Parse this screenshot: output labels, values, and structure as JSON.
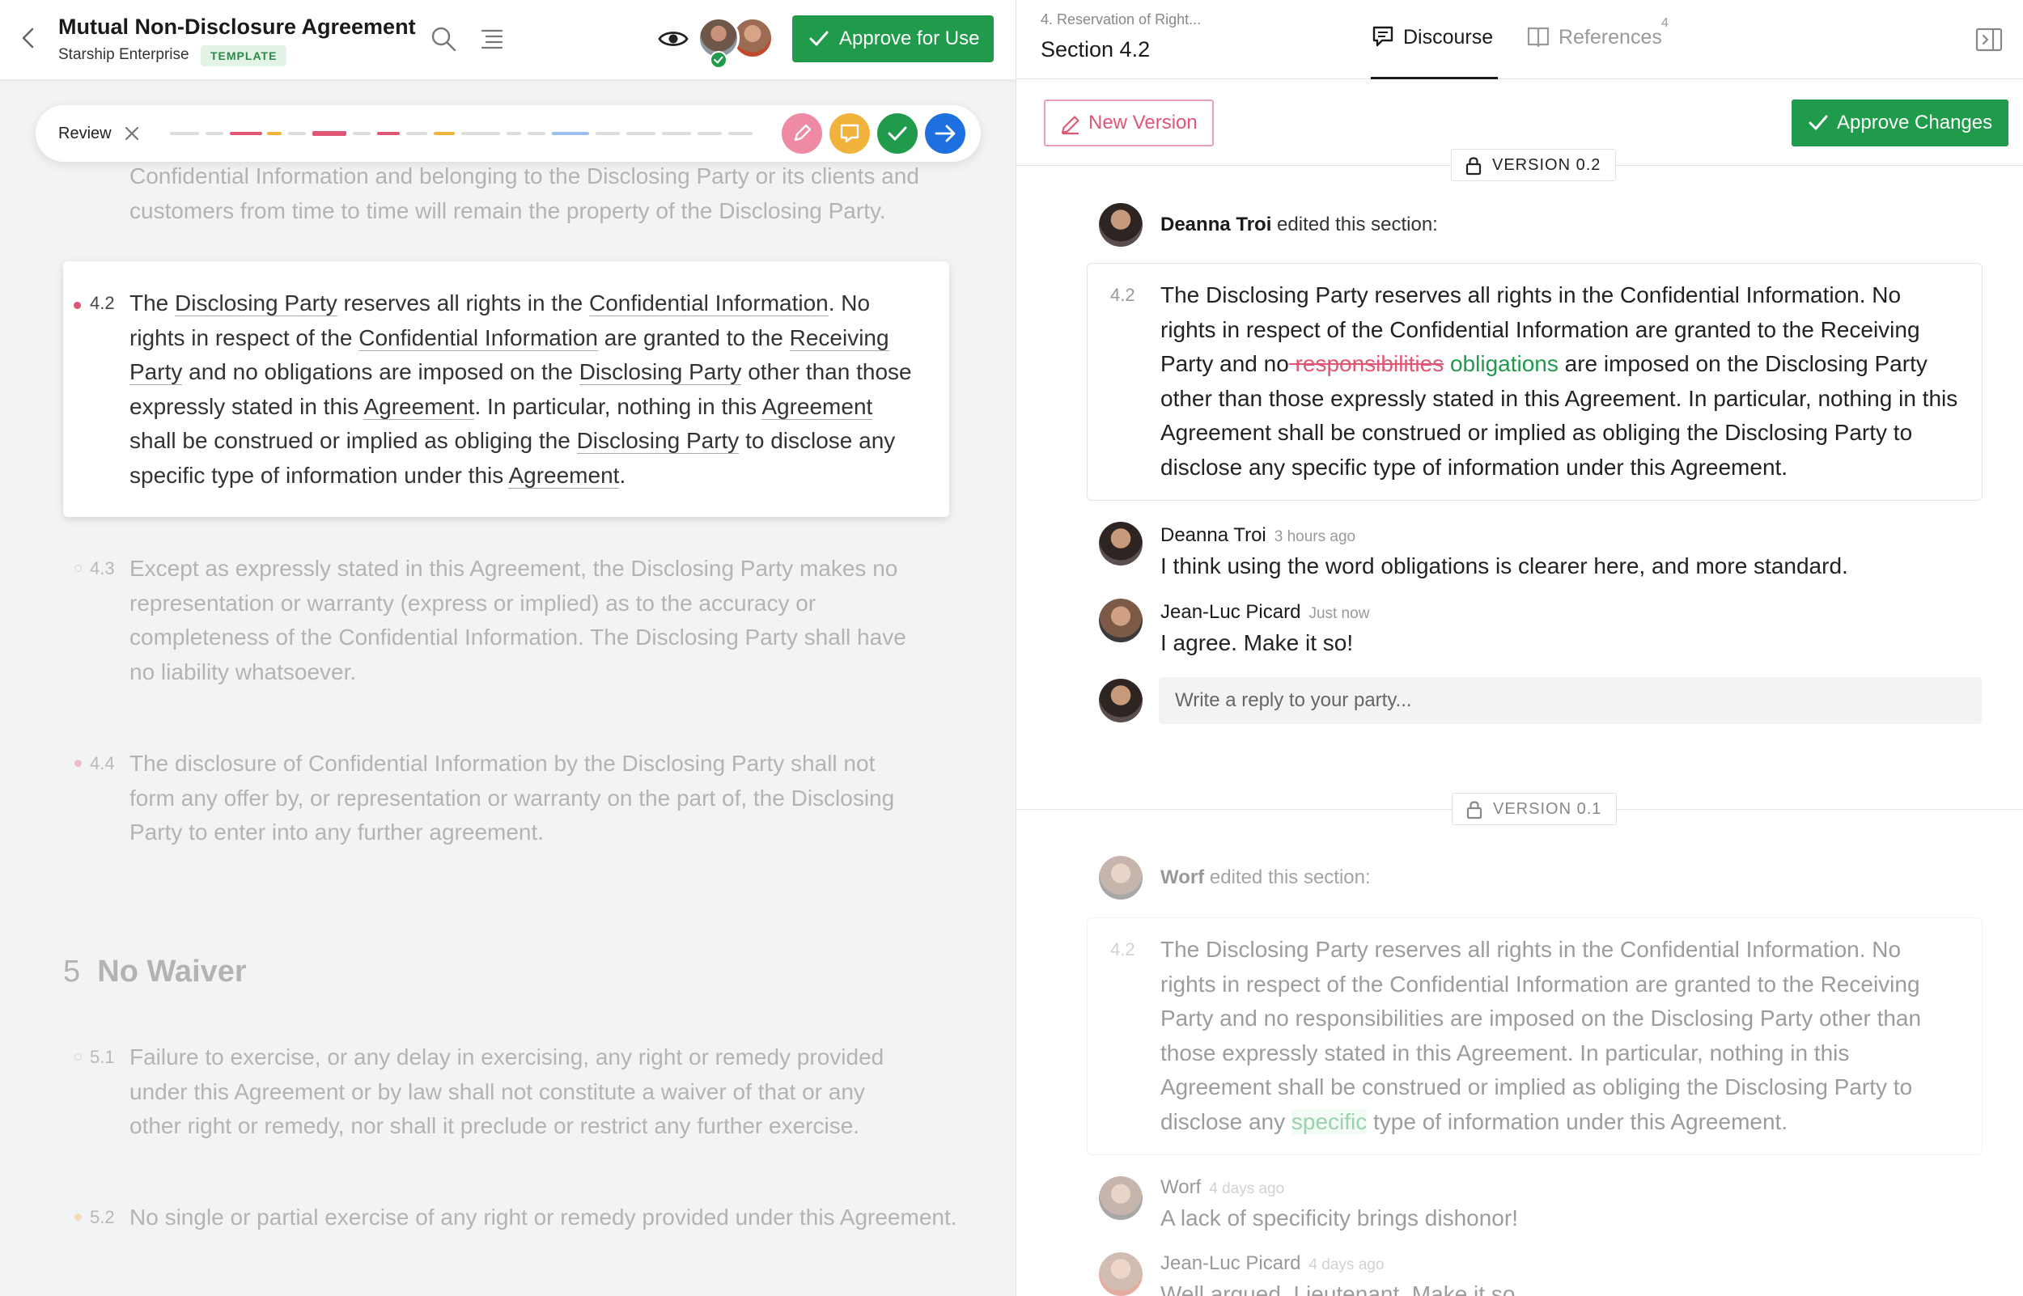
{
  "header": {
    "title": "Mutual Non-Disclosure Agreement",
    "subtitle": "Starship Enterprise",
    "badge": "TEMPLATE",
    "approve_button": "Approve for Use"
  },
  "review": {
    "label": "Review"
  },
  "document": {
    "clause_4_1_tail": "Confidential Information and belonging to the Disclosing Party or its clients and customers from time to time will remain the property of the Disclosing Party.",
    "clause_4_2_num": "4.2",
    "clause_4_2_tokens": [
      "The ",
      "Disclosing Party",
      " reserves all rights in the ",
      "Confidential Information",
      ". No rights in respect of the ",
      "Confidential Information",
      " are granted to the ",
      "Receiving Party",
      " and no obligations are imposed on the ",
      "Disclosing Party",
      " other than those expressly stated in this ",
      "Agreement",
      ". In particular, nothing in this ",
      "Agreement",
      " shall be construed or implied as obliging the ",
      "Disclosing Party",
      " to disclose any specific type of information under this ",
      "Agreement",
      "."
    ],
    "clause_4_3_num": "4.3",
    "clause_4_3": "Except as expressly stated in this Agreement, the Disclosing Party makes no representation or warranty (express or implied) as to the accuracy or completeness of the Confidential Information. The Disclosing Party shall have no liability whatsoever.",
    "clause_4_4_num": "4.4",
    "clause_4_4": "The disclosure of Confidential Information by the Disclosing Party shall not form any offer by, or representation or warranty on the part of, the Disclosing Party to enter into any further agreement.",
    "section_5_num": "5",
    "section_5_title": "No Waiver",
    "clause_5_1_num": "5.1",
    "clause_5_1": "Failure to exercise, or any delay in exercising, any right or remedy provided under this Agreement or by law shall not constitute a waiver of that or any other right or remedy, nor shall it preclude or restrict any further exercise.",
    "clause_5_2_num": "5.2",
    "clause_5_2": "No single or partial exercise of any right or remedy provided under this Agreement."
  },
  "panel": {
    "breadcrumb": "4. Reservation of Right...",
    "section_title": "Section 4.2",
    "tab_discourse": "Discourse",
    "tab_references": "References",
    "references_count": "4",
    "new_version_button": "New Version",
    "approve_changes_button": "Approve Changes",
    "version_2": {
      "label": "VERSION 0.2",
      "editor": "Deanna Troi",
      "edited_suffix": " edited this section:",
      "clause_num": "4.2",
      "text_before": "The Disclosing Party reserves all rights in the Confidential Information. No rights in respect of the Confidential Information are granted to the Receiving Party and no",
      "deleted": " responsibilities",
      "inserted": " obligations",
      "text_after": " are imposed on the Disclosing Party other than those expressly stated in this Agreement. In particular, nothing in this Agreement shall be construed or implied as obliging the Disclosing Party to disclose any specific type of information under this Agreement.",
      "comments": [
        {
          "author": "Deanna Troi",
          "time": "3 hours ago",
          "body": "I think using the word obligations is clearer here, and more standard."
        },
        {
          "author": "Jean-Luc Picard",
          "time": "Just now",
          "body": "I agree. Make it so!"
        }
      ],
      "reply_placeholder": "Write a reply to your party..."
    },
    "version_1": {
      "label": "VERSION 0.1",
      "editor": "Worf",
      "edited_suffix": " edited this section:",
      "clause_num": "4.2",
      "text_before": "The Disclosing Party reserves all rights in the Confidential Information. No rights in respect of the Confidential Information are granted to the Receiving Party and no responsibilities are imposed on the Disclosing Party other than those expressly stated in this Agreement. In particular, nothing in this Agreement shall be construed or implied as obliging the Disclosing Party to disclose any ",
      "inserted": "specific",
      "text_after": " type of information under this Agreement.",
      "comments": [
        {
          "author": "Worf",
          "time": "4 days ago",
          "body": "A lack of specificity brings dishonor!"
        },
        {
          "author": "Jean-Luc Picard",
          "time": "4 days ago",
          "body": "Well argued, Lieutenant. Make it so."
        }
      ]
    }
  },
  "colors": {
    "green": "#1f9b4b",
    "pink": "#e05675",
    "orange": "#f2b33d",
    "blue": "#1e6fe0"
  },
  "icons": [
    "back-icon",
    "search-icon",
    "outline-icon",
    "eye-icon",
    "check-icon",
    "close-icon",
    "pencil-icon",
    "comment-icon",
    "arrow-right-icon",
    "discourse-icon",
    "book-icon",
    "panel-toggle-icon",
    "lock-icon"
  ]
}
